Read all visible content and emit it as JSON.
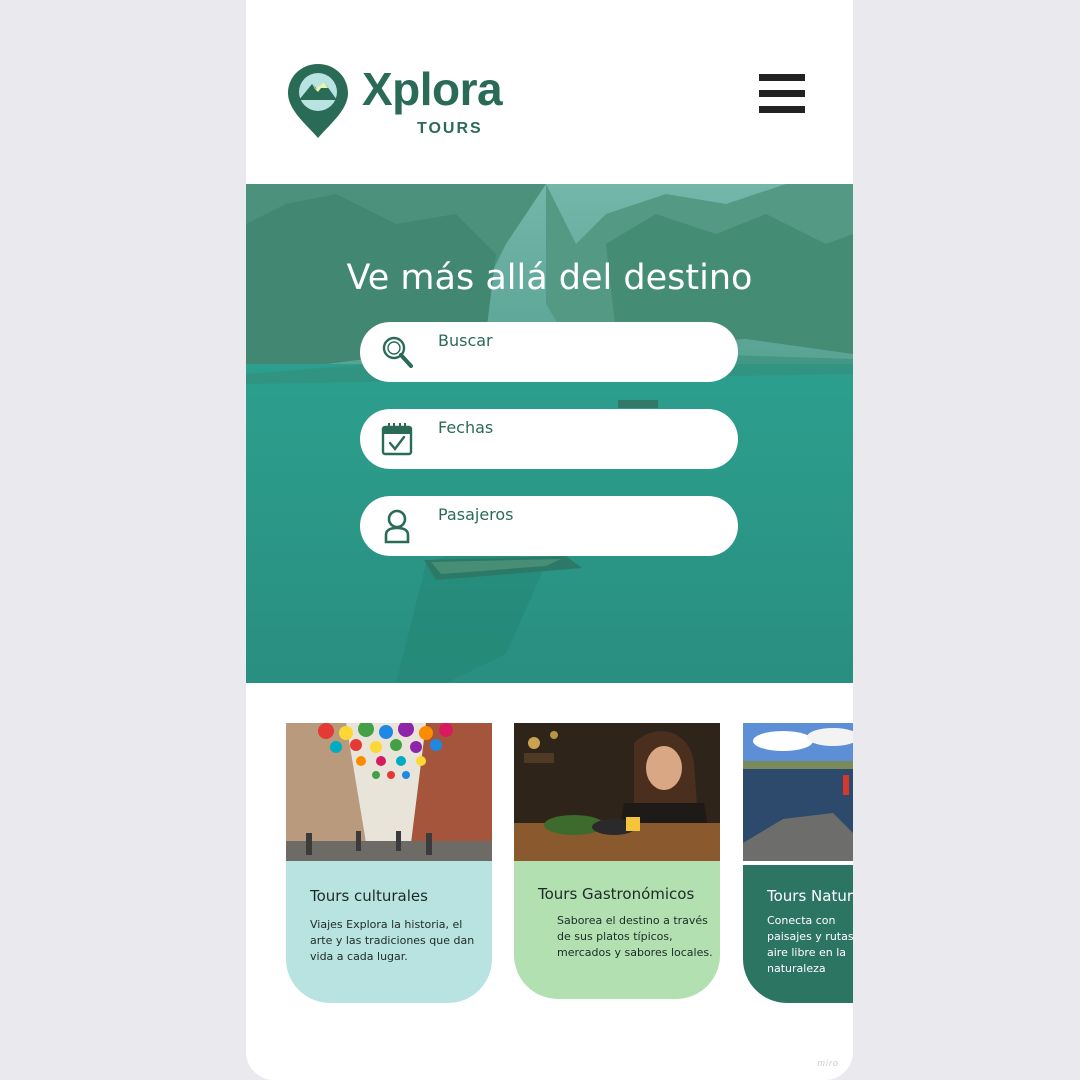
{
  "brand": {
    "name": "Xplora",
    "subtitle": "TOURS",
    "color": "#2a6b57"
  },
  "header": {
    "menu_icon": "hamburger-menu-icon"
  },
  "hero": {
    "title": "Ve más allá del destino",
    "fields": [
      {
        "label": "Buscar",
        "icon": "search-icon"
      },
      {
        "label": "Fechas",
        "icon": "calendar-check-icon"
      },
      {
        "label": "Pasajeros",
        "icon": "user-icon"
      }
    ]
  },
  "cards": [
    {
      "title": "Tours culturales",
      "description": "Viajes Explora la historia, el arte y las tradiciones que dan vida a cada lugar.",
      "color": "#b8e3e0"
    },
    {
      "title": "Tours Gastronómicos",
      "description": "Saborea el destino a través de sus platos típicos, mercados y sabores locales.",
      "color": "#b2e0b0"
    },
    {
      "title": "Tours Naturales",
      "description": "Conecta con paisajes y rutas al aire libre en la naturaleza",
      "color": "#2d7563"
    }
  ],
  "watermark": "miro"
}
